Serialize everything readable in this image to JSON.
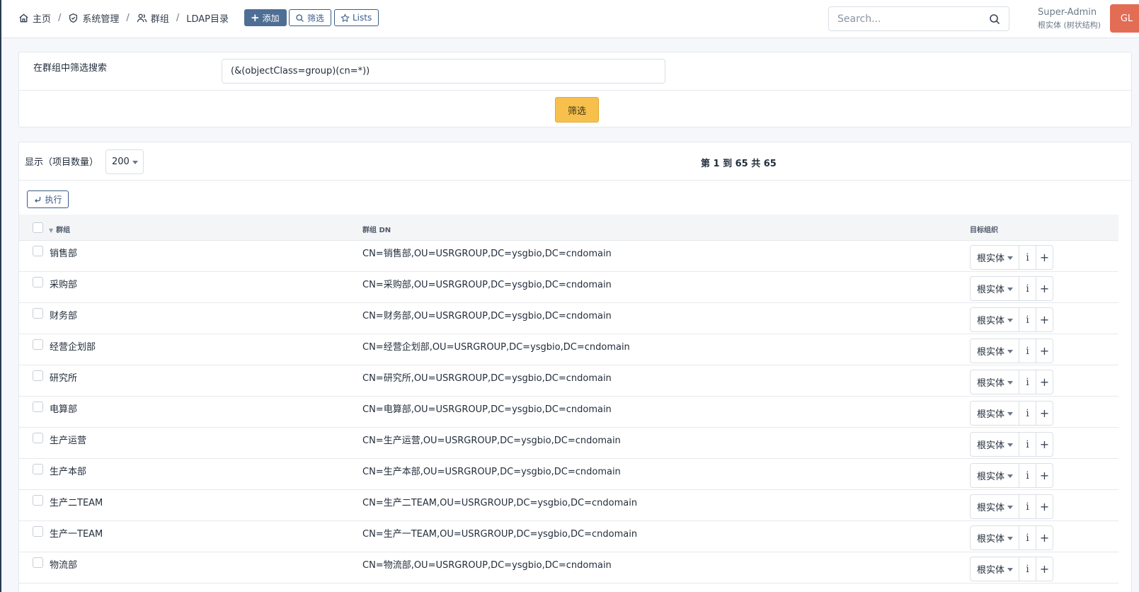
{
  "header": {
    "breadcrumb": [
      {
        "label": "主页",
        "icon": "home-icon"
      },
      {
        "label": "系统管理",
        "icon": "shield-icon"
      },
      {
        "label": "群组",
        "icon": "users-icon"
      },
      {
        "label": "LDAP目录",
        "icon": ""
      }
    ],
    "separator": "/",
    "add_label": "添加",
    "filter_label": "筛选",
    "lists_label": "Lists",
    "search_placeholder": "Search...",
    "user_name": "Super-Admin",
    "user_entity": "根实体 (树状结构)",
    "avatar_initials": "GL",
    "avatar_color": "#e36c55"
  },
  "filter": {
    "label": "在群组中筛选搜索",
    "value": "(&(objectClass=group)(cn=*))",
    "submit_label": "筛选"
  },
  "list": {
    "show_label": "显示（项目数量）",
    "page_size": "200",
    "pagination_info": "第 1 到 65 共 65",
    "execute_label": "执行",
    "columns": {
      "name": "群组",
      "dn": "群组 DN",
      "entity": "目标组织"
    },
    "entity_option": "根实体",
    "info_glyph": "i",
    "add_glyph": "+",
    "rows": [
      {
        "name": "销售部",
        "dn": "CN=销售部,OU=USRGROUP,DC=ysgbio,DC=cndomain"
      },
      {
        "name": "采购部",
        "dn": "CN=采购部,OU=USRGROUP,DC=ysgbio,DC=cndomain"
      },
      {
        "name": "财务部",
        "dn": "CN=财务部,OU=USRGROUP,DC=ysgbio,DC=cndomain"
      },
      {
        "name": "经营企划部",
        "dn": "CN=经营企划部,OU=USRGROUP,DC=ysgbio,DC=cndomain"
      },
      {
        "name": "研究所",
        "dn": "CN=研究所,OU=USRGROUP,DC=ysgbio,DC=cndomain"
      },
      {
        "name": "电算部",
        "dn": "CN=电算部,OU=USRGROUP,DC=ysgbio,DC=cndomain"
      },
      {
        "name": "生产运营",
        "dn": "CN=生产运营,OU=USRGROUP,DC=ysgbio,DC=cndomain"
      },
      {
        "name": "生产本部",
        "dn": "CN=生产本部,OU=USRGROUP,DC=ysgbio,DC=cndomain"
      },
      {
        "name": "生产二TEAM",
        "dn": "CN=生产二TEAM,OU=USRGROUP,DC=ysgbio,DC=cndomain"
      },
      {
        "name": "生产一TEAM",
        "dn": "CN=生产一TEAM,OU=USRGROUP,DC=ysgbio,DC=cndomain"
      },
      {
        "name": "物流部",
        "dn": "CN=物流部,OU=USRGROUP,DC=ysgbio,DC=cndomain"
      }
    ]
  },
  "colors": {
    "accent": "#3a5b89",
    "filter_button": "#f7c04d",
    "primary_button": "#4f6e94"
  }
}
